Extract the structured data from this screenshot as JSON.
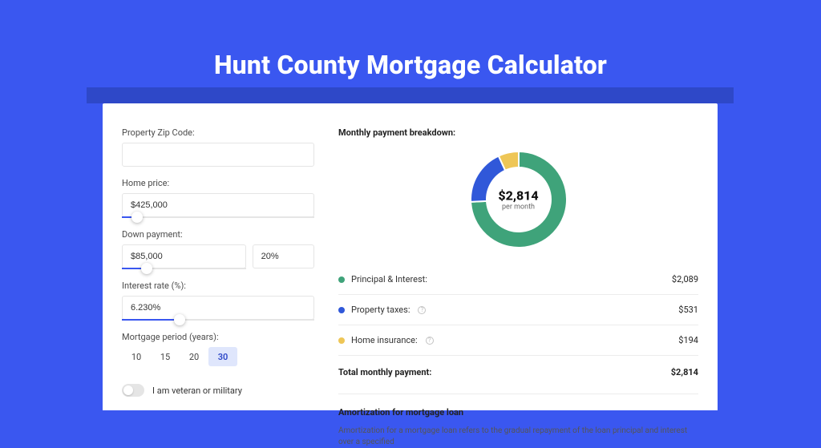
{
  "title": "Hunt County Mortgage Calculator",
  "form": {
    "zip_label": "Property Zip Code:",
    "zip_value": "",
    "price_label": "Home price:",
    "price_value": "$425,000",
    "price_slider_percent": 8,
    "dp_label": "Down payment:",
    "dp_amount_value": "$85,000",
    "dp_percent_value": "20%",
    "dp_slider_percent": 20,
    "rate_label": "Interest rate (%):",
    "rate_value": "6.230%",
    "rate_slider_percent": 30,
    "period_label": "Mortgage period (years):",
    "period_options": [
      "10",
      "15",
      "20",
      "30"
    ],
    "period_selected": "30",
    "veteran_label": "I am veteran or military",
    "veteran_on": false
  },
  "breakdown": {
    "heading": "Monthly payment breakdown:",
    "center_value": "$2,814",
    "center_sub": "per month",
    "items": [
      {
        "label": "Principal & Interest:",
        "value": "$2,089",
        "color": "green",
        "info": false
      },
      {
        "label": "Property taxes:",
        "value": "$531",
        "color": "blue",
        "info": true
      },
      {
        "label": "Home insurance:",
        "value": "$194",
        "color": "yellow",
        "info": true
      }
    ],
    "total_label": "Total monthly payment:",
    "total_value": "$2,814"
  },
  "amort": {
    "heading": "Amortization for mortgage loan",
    "text": "Amortization for a mortgage loan refers to the gradual repayment of the loan principal and interest over a specified"
  },
  "chart_data": {
    "type": "pie",
    "title": "Monthly payment breakdown",
    "series": [
      {
        "name": "Principal & Interest",
        "value": 2089,
        "color": "#3fa37a"
      },
      {
        "name": "Property taxes",
        "value": 531,
        "color": "#3058d9"
      },
      {
        "name": "Home insurance",
        "value": 194,
        "color": "#eec657"
      }
    ],
    "total": 2814
  }
}
